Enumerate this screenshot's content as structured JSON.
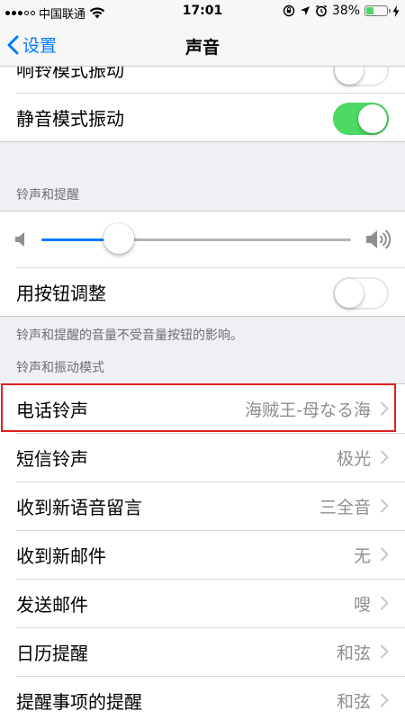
{
  "status_bar": {
    "carrier": "中国联通",
    "time": "17:01",
    "battery_percent": "38%",
    "battery_level": 0.38,
    "battery_color": "#4cd964",
    "icons": [
      "signal-icon",
      "wifi-icon",
      "orientation-lock-icon",
      "location-icon",
      "alarm-icon",
      "battery-icon",
      "charging-icon"
    ]
  },
  "nav": {
    "back_label": "设置",
    "title": "声音"
  },
  "vibrate": {
    "rows": [
      {
        "label": "响铃模式振动",
        "on": false
      },
      {
        "label": "静音模式振动",
        "on": true
      }
    ]
  },
  "ringer": {
    "header": "铃声和提醒",
    "volume_level": 0.25,
    "change_with_buttons_label": "用按钮调整",
    "change_with_buttons_on": false,
    "footer": "铃声和提醒的音量不受音量按钮的影响。"
  },
  "patterns": {
    "header": "铃声和振动模式",
    "rows": [
      {
        "label": "电话铃声",
        "value": "海贼王-母なる海"
      },
      {
        "label": "短信铃声",
        "value": "极光"
      },
      {
        "label": "收到新语音留言",
        "value": "三全音"
      },
      {
        "label": "收到新邮件",
        "value": "无"
      },
      {
        "label": "发送邮件",
        "value": "嗖"
      },
      {
        "label": "日历提醒",
        "value": "和弦"
      },
      {
        "label": "提醒事项的提醒",
        "value": "和弦"
      }
    ]
  },
  "colors": {
    "accent": "#007aff",
    "toggle_on": "#4cd964",
    "highlight": "#e02020"
  }
}
